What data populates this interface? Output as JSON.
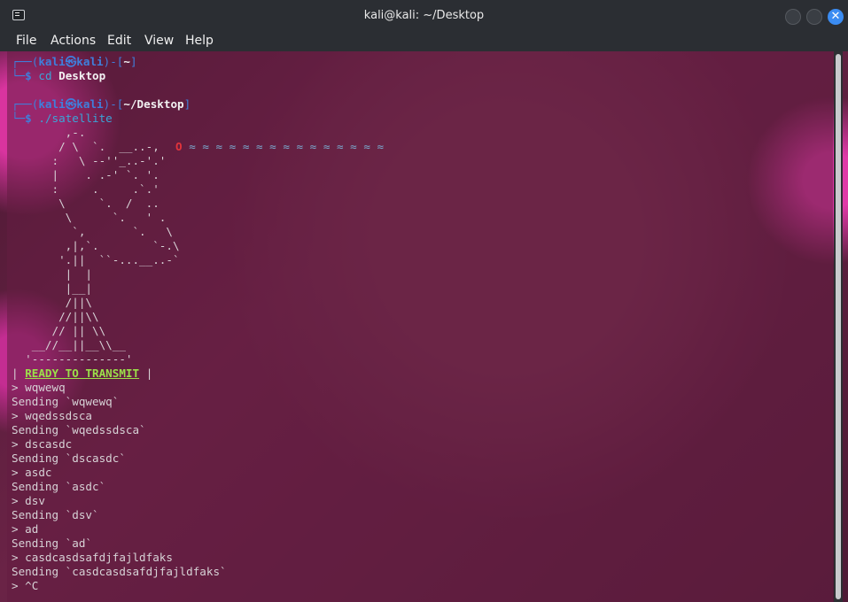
{
  "window": {
    "title": "kali@kali: ~/Desktop"
  },
  "menu": [
    "File",
    "Actions",
    "Edit",
    "View",
    "Help"
  ],
  "prompt1": {
    "bracket_open": "┌──(",
    "user": "kali",
    "at": "㉿",
    "host": "kali",
    "mid": ")-[",
    "path": "~",
    "close": "]",
    "dollar_prefix": "└─",
    "dollar": "$",
    "cmd": "cd",
    "arg": "Desktop"
  },
  "prompt2": {
    "bracket_open": "┌──(",
    "user": "kali",
    "at": "㉿",
    "host": "kali",
    "mid": ")-[",
    "path": "~/Desktop",
    "close": "]",
    "dollar_prefix": "└─",
    "dollar": "$",
    "cmd": "./satellite"
  },
  "ascii": [
    "        ,-.",
    "       / \\  `.  __..-,",
    "      :   \\ --''_..-'.'",
    "      |    . .-' `. '.",
    "      :     .     .`.'",
    "       \\     `.  /  ..",
    "        \\      `.   ' .",
    "         `,       `.   \\",
    "        ,|,`.        `-.\\",
    "       '.||  ``-...__..-`",
    "        |  |",
    "        |__|",
    "        /||\\",
    "       //||\\\\",
    "      // || \\\\",
    "   __//__||__\\\\__",
    "  '--------------'"
  ],
  "dish_tip": "O",
  "waves": "≈ ≈ ≈ ≈ ≈ ≈ ≈ ≈ ≈ ≈ ≈ ≈ ≈ ≈ ≈",
  "status": {
    "bar_left": "|",
    "ready": "READY TO TRANSMIT",
    "bar_right": "|"
  },
  "session": [
    "> wqwewq",
    "Sending `wqwewq`",
    "> wqedssdsca",
    "Sending `wqedssdsca`",
    "> dscasdc",
    "Sending `dscasdc`",
    "> asdc",
    "Sending `asdc`",
    "> dsv",
    "Sending `dsv`",
    "> ad",
    "Sending `ad`",
    "> casdcasdsafdjfajldfaks",
    "Sending `casdcasdsafdjfajldfaks`",
    "> ^C"
  ]
}
